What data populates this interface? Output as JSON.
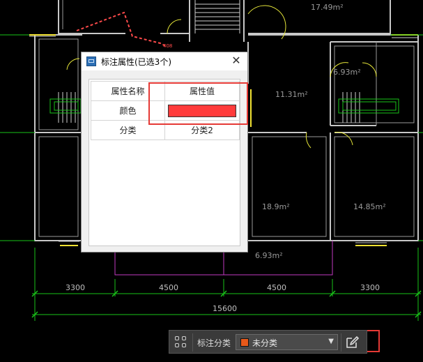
{
  "rooms": {
    "area_top_right": "17.49m²",
    "area_small_right": "6.93m²",
    "area_center": "11.31m²",
    "area_mid_left": "18.9m²",
    "area_mid_right": "14.85m²",
    "area_bottom_center": "6.93m²"
  },
  "dimensions": {
    "seg1": "3300",
    "seg2": "4500",
    "seg3": "4500",
    "seg4": "3300",
    "total": "15600"
  },
  "dialog": {
    "title": "标注属性(已选3个)",
    "close_glyph": "✕",
    "header_name": "属性名称",
    "header_value": "属性值",
    "rows": [
      {
        "name": "颜色",
        "value": "",
        "color": "#ff3b3b"
      },
      {
        "name": "分类",
        "value": "分类2"
      }
    ]
  },
  "toolbar": {
    "label": "标注分类",
    "select_value": "未分类",
    "select_color": "#e8591a",
    "icons": [
      "grid-icon",
      "chevron-down-icon",
      "edit-icon"
    ]
  }
}
